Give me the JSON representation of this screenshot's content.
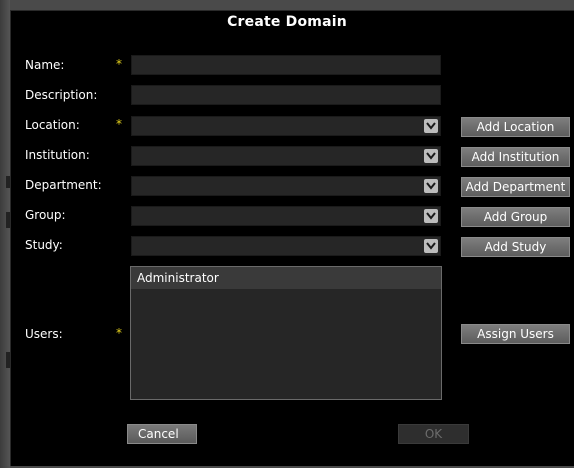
{
  "dialog": {
    "title": "Create Domain"
  },
  "fields": {
    "name": {
      "label": "Name:",
      "value": "",
      "required": true
    },
    "description": {
      "label": "Description:",
      "value": ""
    },
    "location": {
      "label": "Location:",
      "value": "",
      "required": true
    },
    "institution": {
      "label": "Institution:",
      "value": ""
    },
    "department": {
      "label": "Department:",
      "value": ""
    },
    "group": {
      "label": "Group:",
      "value": ""
    },
    "study": {
      "label": "Study:",
      "value": ""
    },
    "users": {
      "label": "Users:",
      "required": true,
      "items": [
        "Administrator"
      ]
    }
  },
  "required_marker": "*",
  "buttons": {
    "add_location": "Add Location",
    "add_institution": "Add Institution",
    "add_department": "Add Department",
    "add_group": "Add Group",
    "add_study": "Add Study",
    "assign_users": "Assign Users",
    "cancel": "Cancel",
    "ok": "OK"
  },
  "icons": {
    "combo_arrow": "chevron-down-icon"
  },
  "colors": {
    "background": "#000000",
    "field": "#262626",
    "required_star": "#e6d21e",
    "button": "#6e6e6e",
    "disabled_text": "#6c6c6c"
  }
}
